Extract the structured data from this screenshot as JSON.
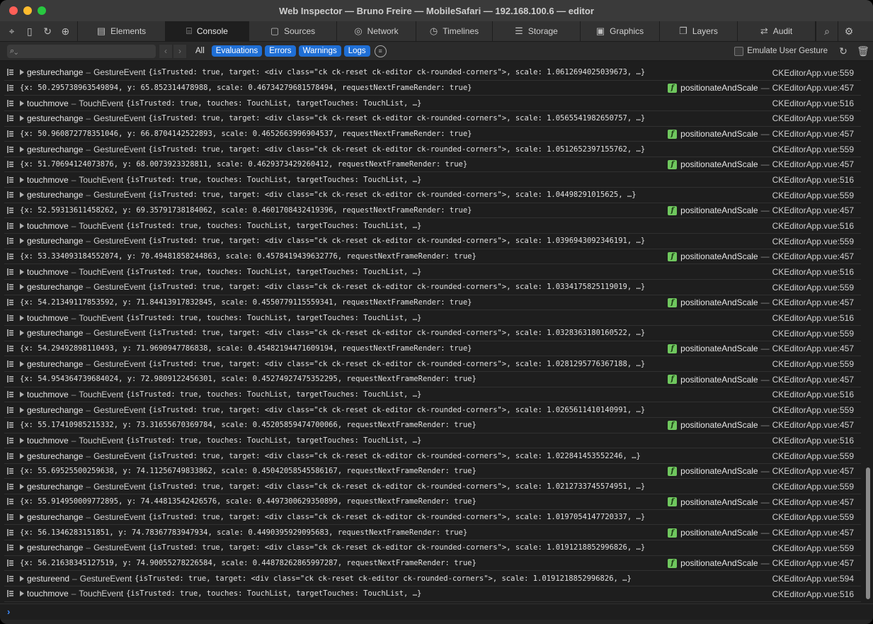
{
  "window": {
    "title": "Web Inspector — Bruno Freire — MobileSafari — 192.168.100.6 — editor"
  },
  "tabs": [
    {
      "label": "Elements",
      "icon": "elements-icon",
      "active": false
    },
    {
      "label": "Console",
      "icon": "console-icon",
      "active": true
    },
    {
      "label": "Sources",
      "icon": "document-icon",
      "active": false
    },
    {
      "label": "Network",
      "icon": "network-icon",
      "active": false
    },
    {
      "label": "Timelines",
      "icon": "clock-icon",
      "active": false
    },
    {
      "label": "Storage",
      "icon": "database-icon",
      "active": false
    },
    {
      "label": "Graphics",
      "icon": "image-icon",
      "active": false
    },
    {
      "label": "Layers",
      "icon": "layers-icon",
      "active": false
    },
    {
      "label": "Audit",
      "icon": "audit-icon",
      "active": false
    }
  ],
  "filter": {
    "all_label": "All",
    "evaluations_label": "Evaluations",
    "errors_label": "Errors",
    "warnings_label": "Warnings",
    "logs_label": "Logs",
    "emulate_label": "Emulate User Gesture"
  },
  "rows": [
    {
      "kind": "ge",
      "name": "gesturechange",
      "type": "GestureEvent",
      "payload": "{isTrusted: true, target: <div class=\"ck ck-reset ck-editor ck-rounded-corners\">, scale: 1.0612694025039673, …}",
      "fn": "",
      "file": "CKEditorApp.vue:559"
    },
    {
      "kind": "obj",
      "name": "",
      "type": "",
      "payload": "{x: 50.295738963549894, y: 65.852314478988, scale: 0.46734279681578494, requestNextFrameRender: true}",
      "fn": "positionateAndScale",
      "file": "CKEditorApp.vue:457"
    },
    {
      "kind": "te",
      "name": "touchmove",
      "type": "TouchEvent",
      "payload": "{isTrusted: true, touches: TouchList, targetTouches: TouchList, …}",
      "fn": "",
      "file": "CKEditorApp.vue:516"
    },
    {
      "kind": "ge",
      "name": "gesturechange",
      "type": "GestureEvent",
      "payload": "{isTrusted: true, target: <div class=\"ck ck-reset ck-editor ck-rounded-corners\">, scale: 1.0565541982650757, …}",
      "fn": "",
      "file": "CKEditorApp.vue:559"
    },
    {
      "kind": "obj",
      "name": "",
      "type": "",
      "payload": "{x: 50.960872778351046, y: 66.8704142522893, scale: 0.4652663996904537, requestNextFrameRender: true}",
      "fn": "positionateAndScale",
      "file": "CKEditorApp.vue:457"
    },
    {
      "kind": "ge",
      "name": "gesturechange",
      "type": "GestureEvent",
      "payload": "{isTrusted: true, target: <div class=\"ck ck-reset ck-editor ck-rounded-corners\">, scale: 1.0512652397155762, …}",
      "fn": "",
      "file": "CKEditorApp.vue:559"
    },
    {
      "kind": "obj",
      "name": "",
      "type": "",
      "payload": "{x: 51.70694124073876, y: 68.0073923328811, scale: 0.4629373429260412, requestNextFrameRender: true}",
      "fn": "positionateAndScale",
      "file": "CKEditorApp.vue:457"
    },
    {
      "kind": "te",
      "name": "touchmove",
      "type": "TouchEvent",
      "payload": "{isTrusted: true, touches: TouchList, targetTouches: TouchList, …}",
      "fn": "",
      "file": "CKEditorApp.vue:516"
    },
    {
      "kind": "ge",
      "name": "gesturechange",
      "type": "GestureEvent",
      "payload": "{isTrusted: true, target: <div class=\"ck ck-reset ck-editor ck-rounded-corners\">, scale: 1.04498291015625, …}",
      "fn": "",
      "file": "CKEditorApp.vue:559"
    },
    {
      "kind": "obj",
      "name": "",
      "type": "",
      "payload": "{x: 52.59313611458262, y: 69.35791738184062, scale: 0.4601708432419396, requestNextFrameRender: true}",
      "fn": "positionateAndScale",
      "file": "CKEditorApp.vue:457"
    },
    {
      "kind": "te",
      "name": "touchmove",
      "type": "TouchEvent",
      "payload": "{isTrusted: true, touches: TouchList, targetTouches: TouchList, …}",
      "fn": "",
      "file": "CKEditorApp.vue:516"
    },
    {
      "kind": "ge",
      "name": "gesturechange",
      "type": "GestureEvent",
      "payload": "{isTrusted: true, target: <div class=\"ck ck-reset ck-editor ck-rounded-corners\">, scale: 1.0396943092346191, …}",
      "fn": "",
      "file": "CKEditorApp.vue:559"
    },
    {
      "kind": "obj",
      "name": "",
      "type": "",
      "payload": "{x: 53.334093184552074, y: 70.49481858244863, scale: 0.4578419439632776, requestNextFrameRender: true}",
      "fn": "positionateAndScale",
      "file": "CKEditorApp.vue:457"
    },
    {
      "kind": "te",
      "name": "touchmove",
      "type": "TouchEvent",
      "payload": "{isTrusted: true, touches: TouchList, targetTouches: TouchList, …}",
      "fn": "",
      "file": "CKEditorApp.vue:516"
    },
    {
      "kind": "ge",
      "name": "gesturechange",
      "type": "GestureEvent",
      "payload": "{isTrusted: true, target: <div class=\"ck ck-reset ck-editor ck-rounded-corners\">, scale: 1.0334175825119019, …}",
      "fn": "",
      "file": "CKEditorApp.vue:559"
    },
    {
      "kind": "obj",
      "name": "",
      "type": "",
      "payload": "{x: 54.21349117853592, y: 71.84413917832845, scale: 0.4550779115559341, requestNextFrameRender: true}",
      "fn": "positionateAndScale",
      "file": "CKEditorApp.vue:457"
    },
    {
      "kind": "te",
      "name": "touchmove",
      "type": "TouchEvent",
      "payload": "{isTrusted: true, touches: TouchList, targetTouches: TouchList, …}",
      "fn": "",
      "file": "CKEditorApp.vue:516"
    },
    {
      "kind": "ge",
      "name": "gesturechange",
      "type": "GestureEvent",
      "payload": "{isTrusted: true, target: <div class=\"ck ck-reset ck-editor ck-rounded-corners\">, scale: 1.0328363180160522, …}",
      "fn": "",
      "file": "CKEditorApp.vue:559"
    },
    {
      "kind": "obj",
      "name": "",
      "type": "",
      "payload": "{x: 54.29492898110493, y: 71.9690947786838, scale: 0.45482194471609194, requestNextFrameRender: true}",
      "fn": "positionateAndScale",
      "file": "CKEditorApp.vue:457"
    },
    {
      "kind": "ge",
      "name": "gesturechange",
      "type": "GestureEvent",
      "payload": "{isTrusted: true, target: <div class=\"ck ck-reset ck-editor ck-rounded-corners\">, scale: 1.0281295776367188, …}",
      "fn": "",
      "file": "CKEditorApp.vue:559"
    },
    {
      "kind": "obj",
      "name": "",
      "type": "",
      "payload": "{x: 54.954364739684024, y: 72.9809122456301, scale: 0.45274927475352295, requestNextFrameRender: true}",
      "fn": "positionateAndScale",
      "file": "CKEditorApp.vue:457"
    },
    {
      "kind": "te",
      "name": "touchmove",
      "type": "TouchEvent",
      "payload": "{isTrusted: true, touches: TouchList, targetTouches: TouchList, …}",
      "fn": "",
      "file": "CKEditorApp.vue:516"
    },
    {
      "kind": "ge",
      "name": "gesturechange",
      "type": "GestureEvent",
      "payload": "{isTrusted: true, target: <div class=\"ck ck-reset ck-editor ck-rounded-corners\">, scale: 1.0265611410140991, …}",
      "fn": "",
      "file": "CKEditorApp.vue:559"
    },
    {
      "kind": "obj",
      "name": "",
      "type": "",
      "payload": "{x: 55.17410985215332, y: 73.31655670369784, scale: 0.45205859474700066, requestNextFrameRender: true}",
      "fn": "positionateAndScale",
      "file": "CKEditorApp.vue:457"
    },
    {
      "kind": "te",
      "name": "touchmove",
      "type": "TouchEvent",
      "payload": "{isTrusted: true, touches: TouchList, targetTouches: TouchList, …}",
      "fn": "",
      "file": "CKEditorApp.vue:516"
    },
    {
      "kind": "ge",
      "name": "gesturechange",
      "type": "GestureEvent",
      "payload": "{isTrusted: true, target: <div class=\"ck ck-reset ck-editor ck-rounded-corners\">, scale: 1.022841453552246, …}",
      "fn": "",
      "file": "CKEditorApp.vue:559"
    },
    {
      "kind": "obj",
      "name": "",
      "type": "",
      "payload": "{x: 55.69525500259638, y: 74.11256749833862, scale: 0.45042058545586167, requestNextFrameRender: true}",
      "fn": "positionateAndScale",
      "file": "CKEditorApp.vue:457"
    },
    {
      "kind": "ge",
      "name": "gesturechange",
      "type": "GestureEvent",
      "payload": "{isTrusted: true, target: <div class=\"ck ck-reset ck-editor ck-rounded-corners\">, scale: 1.0212733745574951, …}",
      "fn": "",
      "file": "CKEditorApp.vue:559"
    },
    {
      "kind": "obj",
      "name": "",
      "type": "",
      "payload": "{x: 55.914950009772895, y: 74.44813542426576, scale: 0.4497300629350899, requestNextFrameRender: true}",
      "fn": "positionateAndScale",
      "file": "CKEditorApp.vue:457"
    },
    {
      "kind": "ge",
      "name": "gesturechange",
      "type": "GestureEvent",
      "payload": "{isTrusted: true, target: <div class=\"ck ck-reset ck-editor ck-rounded-corners\">, scale: 1.0197054147720337, …}",
      "fn": "",
      "file": "CKEditorApp.vue:559"
    },
    {
      "kind": "obj",
      "name": "",
      "type": "",
      "payload": "{x: 56.1346283151851, y: 74.78367783947934, scale: 0.4490395929095683, requestNextFrameRender: true}",
      "fn": "positionateAndScale",
      "file": "CKEditorApp.vue:457"
    },
    {
      "kind": "ge",
      "name": "gesturechange",
      "type": "GestureEvent",
      "payload": "{isTrusted: true, target: <div class=\"ck ck-reset ck-editor ck-rounded-corners\">, scale: 1.0191218852996826, …}",
      "fn": "",
      "file": "CKEditorApp.vue:559"
    },
    {
      "kind": "obj",
      "name": "",
      "type": "",
      "payload": "{x: 56.21638345127519, y: 74.90055278226584, scale: 0.44878262865997287, requestNextFrameRender: true}",
      "fn": "positionateAndScale",
      "file": "CKEditorApp.vue:457"
    },
    {
      "kind": "ge",
      "name": "gestureend",
      "type": "GestureEvent",
      "payload": "{isTrusted: true, target: <div class=\"ck ck-reset ck-editor ck-rounded-corners\">, scale: 1.0191218852996826, …}",
      "fn": "",
      "file": "CKEditorApp.vue:594"
    },
    {
      "kind": "te",
      "name": "touchmove",
      "type": "TouchEvent",
      "payload": "{isTrusted: true, touches: TouchList, targetTouches: TouchList, …}",
      "fn": "",
      "file": "CKEditorApp.vue:516"
    }
  ]
}
